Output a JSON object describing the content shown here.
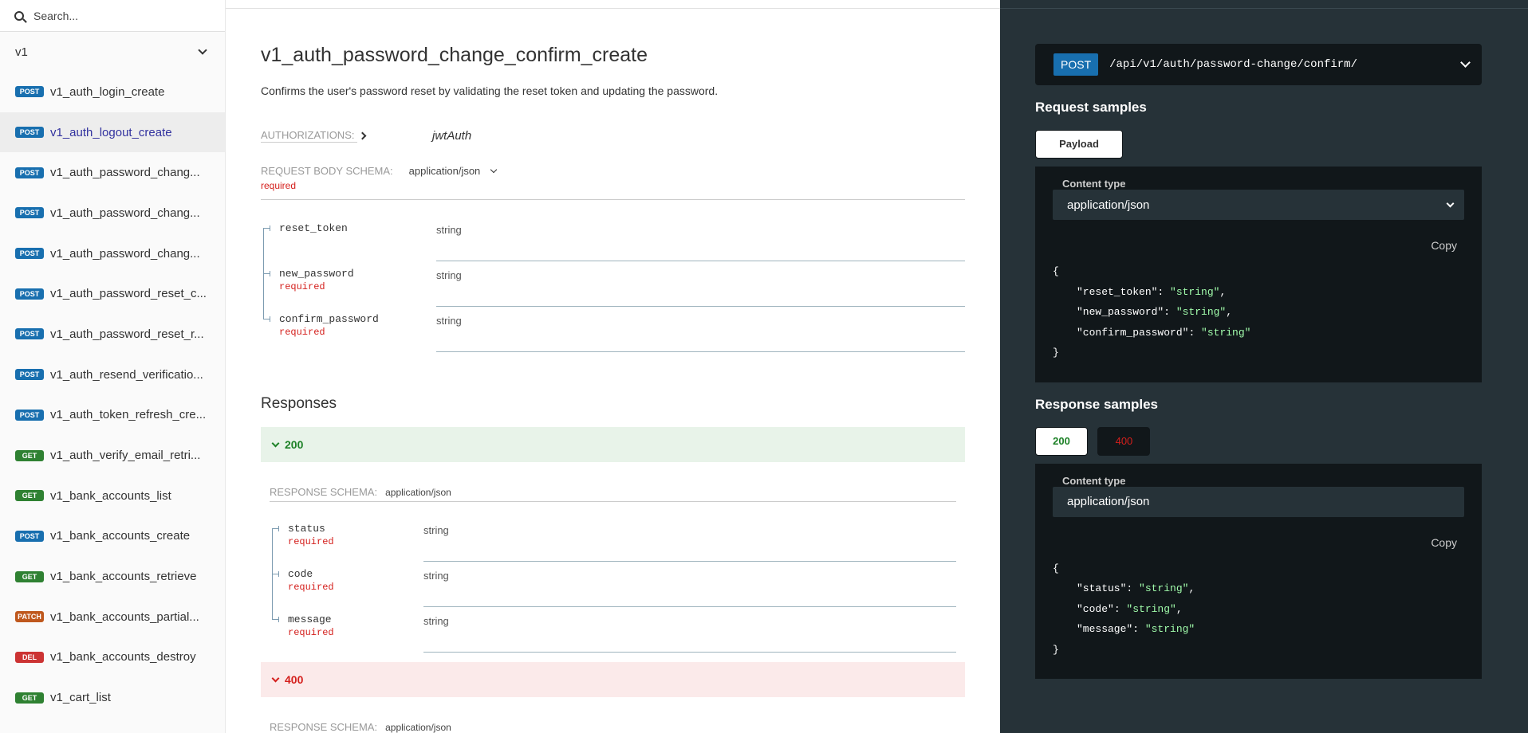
{
  "sidebar": {
    "search_placeholder": "Search...",
    "version": "v1",
    "items": [
      {
        "method": "POST",
        "cls": "post",
        "label": "v1_auth_login_create",
        "active": false
      },
      {
        "method": "POST",
        "cls": "post",
        "label": "v1_auth_logout_create",
        "active": true
      },
      {
        "method": "POST",
        "cls": "post",
        "label": "v1_auth_password_chang...",
        "active": false
      },
      {
        "method": "POST",
        "cls": "post",
        "label": "v1_auth_password_chang...",
        "active": false
      },
      {
        "method": "POST",
        "cls": "post",
        "label": "v1_auth_password_chang...",
        "active": false
      },
      {
        "method": "POST",
        "cls": "post",
        "label": "v1_auth_password_reset_c...",
        "active": false
      },
      {
        "method": "POST",
        "cls": "post",
        "label": "v1_auth_password_reset_r...",
        "active": false
      },
      {
        "method": "POST",
        "cls": "post",
        "label": "v1_auth_resend_verificatio...",
        "active": false
      },
      {
        "method": "POST",
        "cls": "post",
        "label": "v1_auth_token_refresh_cre...",
        "active": false
      },
      {
        "method": "GET",
        "cls": "get",
        "label": "v1_auth_verify_email_retri...",
        "active": false
      },
      {
        "method": "GET",
        "cls": "get",
        "label": "v1_bank_accounts_list",
        "active": false
      },
      {
        "method": "POST",
        "cls": "post",
        "label": "v1_bank_accounts_create",
        "active": false
      },
      {
        "method": "GET",
        "cls": "get",
        "label": "v1_bank_accounts_retrieve",
        "active": false
      },
      {
        "method": "PATCH",
        "cls": "patch",
        "label": "v1_bank_accounts_partial...",
        "active": false
      },
      {
        "method": "DEL",
        "cls": "del",
        "label": "v1_bank_accounts_destroy",
        "active": false
      },
      {
        "method": "GET",
        "cls": "get",
        "label": "v1_cart_list",
        "active": false
      }
    ]
  },
  "main": {
    "title": "v1_auth_password_change_confirm_create",
    "description": "Confirms the user's password reset by validating the reset token and updating the password.",
    "authorizations_label": "AUTHORIZATIONS:",
    "authorizations_value": "jwtAuth",
    "request_body_label": "REQUEST BODY SCHEMA:",
    "request_body_type": "application/json",
    "required_label": "required",
    "request_props": [
      {
        "name": "reset_token",
        "required": "",
        "type": "string"
      },
      {
        "name": "new_password",
        "required": "required",
        "type": "string"
      },
      {
        "name": "confirm_password",
        "required": "required",
        "type": "string"
      }
    ],
    "responses_title": "Responses",
    "response_200": {
      "code": "200",
      "schema_label": "RESPONSE SCHEMA:",
      "schema_type": "application/json",
      "props": [
        {
          "name": "status",
          "required": "required",
          "type": "string"
        },
        {
          "name": "code",
          "required": "required",
          "type": "string"
        },
        {
          "name": "message",
          "required": "required",
          "type": "string"
        }
      ]
    },
    "response_400": {
      "code": "400",
      "schema_label": "RESPONSE SCHEMA:",
      "schema_type": "application/json"
    }
  },
  "right": {
    "method": "POST",
    "path": "/api/v1/auth/password-change/confirm/",
    "request_samples_title": "Request samples",
    "payload_tab": "Payload",
    "content_type_label": "Content type",
    "content_type_value": "application/json",
    "copy_label": "Copy",
    "request_json": [
      {
        "key": "\"reset_token\"",
        "value": "\"string\"",
        "comma": ","
      },
      {
        "key": "\"new_password\"",
        "value": "\"string\"",
        "comma": ","
      },
      {
        "key": "\"confirm_password\"",
        "value": "\"string\"",
        "comma": ""
      }
    ],
    "response_samples_title": "Response samples",
    "tab_200": "200",
    "tab_400": "400",
    "response_json": [
      {
        "key": "\"status\"",
        "value": "\"string\"",
        "comma": ","
      },
      {
        "key": "\"code\"",
        "value": "\"string\"",
        "comma": ","
      },
      {
        "key": "\"message\"",
        "value": "\"string\"",
        "comma": ""
      }
    ],
    "brace_open": "{",
    "brace_close": "}"
  }
}
